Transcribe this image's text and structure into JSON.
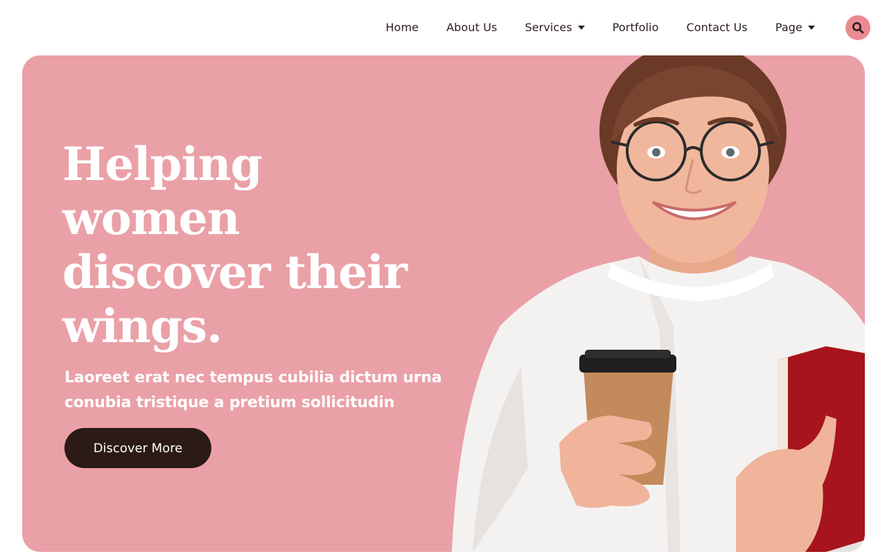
{
  "nav": {
    "items": [
      {
        "label": "Home",
        "has_dropdown": false
      },
      {
        "label": "About Us",
        "has_dropdown": false
      },
      {
        "label": "Services",
        "has_dropdown": true
      },
      {
        "label": "Portfolio",
        "has_dropdown": false
      },
      {
        "label": "Contact Us",
        "has_dropdown": false
      },
      {
        "label": "Page",
        "has_dropdown": true
      }
    ],
    "search_icon": "search-icon"
  },
  "hero": {
    "title_lines": [
      "Helping",
      "women",
      "discover their",
      "wings."
    ],
    "subtitle_line1": "Laoreet erat nec tempus cubilia dictum urna",
    "subtitle_line2": "conubia tristique a pretium sollicitudin",
    "cta_label": "Discover More",
    "image": "smiling woman with glasses holding coffee cup and red book"
  },
  "colors": {
    "hero_background": "#eaa0a7",
    "accent": "#ec8a91",
    "button_dark": "#2b1a15",
    "text_dark": "#2a1f1c"
  }
}
